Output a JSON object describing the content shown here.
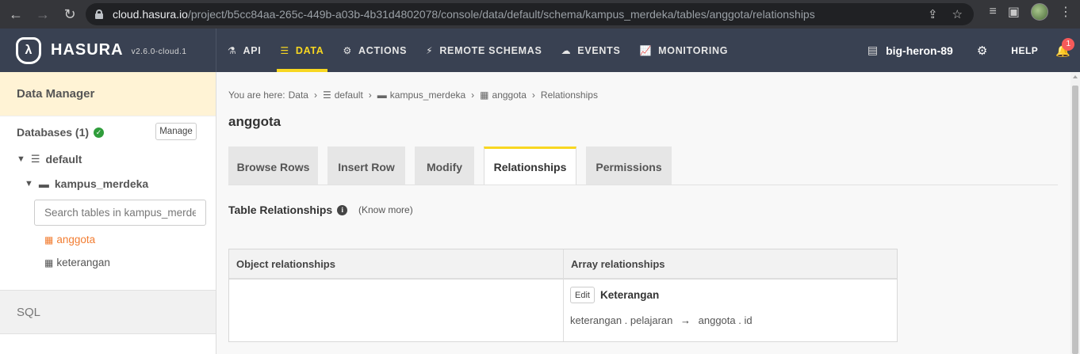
{
  "browser": {
    "url_prefix": "cloud.hasura.io",
    "url_path": "/project/b5cc84aa-265c-449b-a03b-4b31d4802078/console/data/default/schema/kampus_merdeka/tables/anggota/relationships"
  },
  "header": {
    "brand": "HASURA",
    "version": "v2.6.0-cloud.1",
    "menu": [
      {
        "label": "API",
        "icon": "flask-icon"
      },
      {
        "label": "DATA",
        "icon": "database-icon",
        "active": true
      },
      {
        "label": "ACTIONS",
        "icon": "cogs-icon"
      },
      {
        "label": "REMOTE SCHEMAS",
        "icon": "plug-icon"
      },
      {
        "label": "EVENTS",
        "icon": "cloud-icon"
      },
      {
        "label": "MONITORING",
        "icon": "line-chart-icon"
      }
    ],
    "project_name": "big-heron-89",
    "help": "HELP",
    "notification_count": "1"
  },
  "sidebar": {
    "title": "Data Manager",
    "databases_label": "Databases (1)",
    "manage_label": "Manage",
    "database": "default",
    "schema": "kampus_merdeka",
    "search_placeholder": "Search tables in kampus_merdeka....",
    "tables": [
      {
        "name": "anggota",
        "active": true
      },
      {
        "name": "keterangan",
        "active": false
      }
    ],
    "sql_label": "SQL"
  },
  "main": {
    "breadcrumb": {
      "prefix": "You are here:",
      "data": "Data",
      "database": "default",
      "schema": "kampus_merdeka",
      "table": "anggota",
      "current": "Relationships"
    },
    "title": "anggota",
    "tabs": [
      "Browse Rows",
      "Insert Row",
      "Modify",
      "Relationships",
      "Permissions"
    ],
    "active_tab": "Relationships",
    "section_title": "Table Relationships",
    "know_more": "(Know more)",
    "table": {
      "object_header": "Object relationships",
      "array_header": "Array relationships",
      "array_rows": [
        {
          "edit_label": "Edit",
          "name": "Keterangan",
          "from": "keterangan . pelajaran",
          "arrow": "→",
          "to": "anggota . id"
        }
      ]
    }
  }
}
